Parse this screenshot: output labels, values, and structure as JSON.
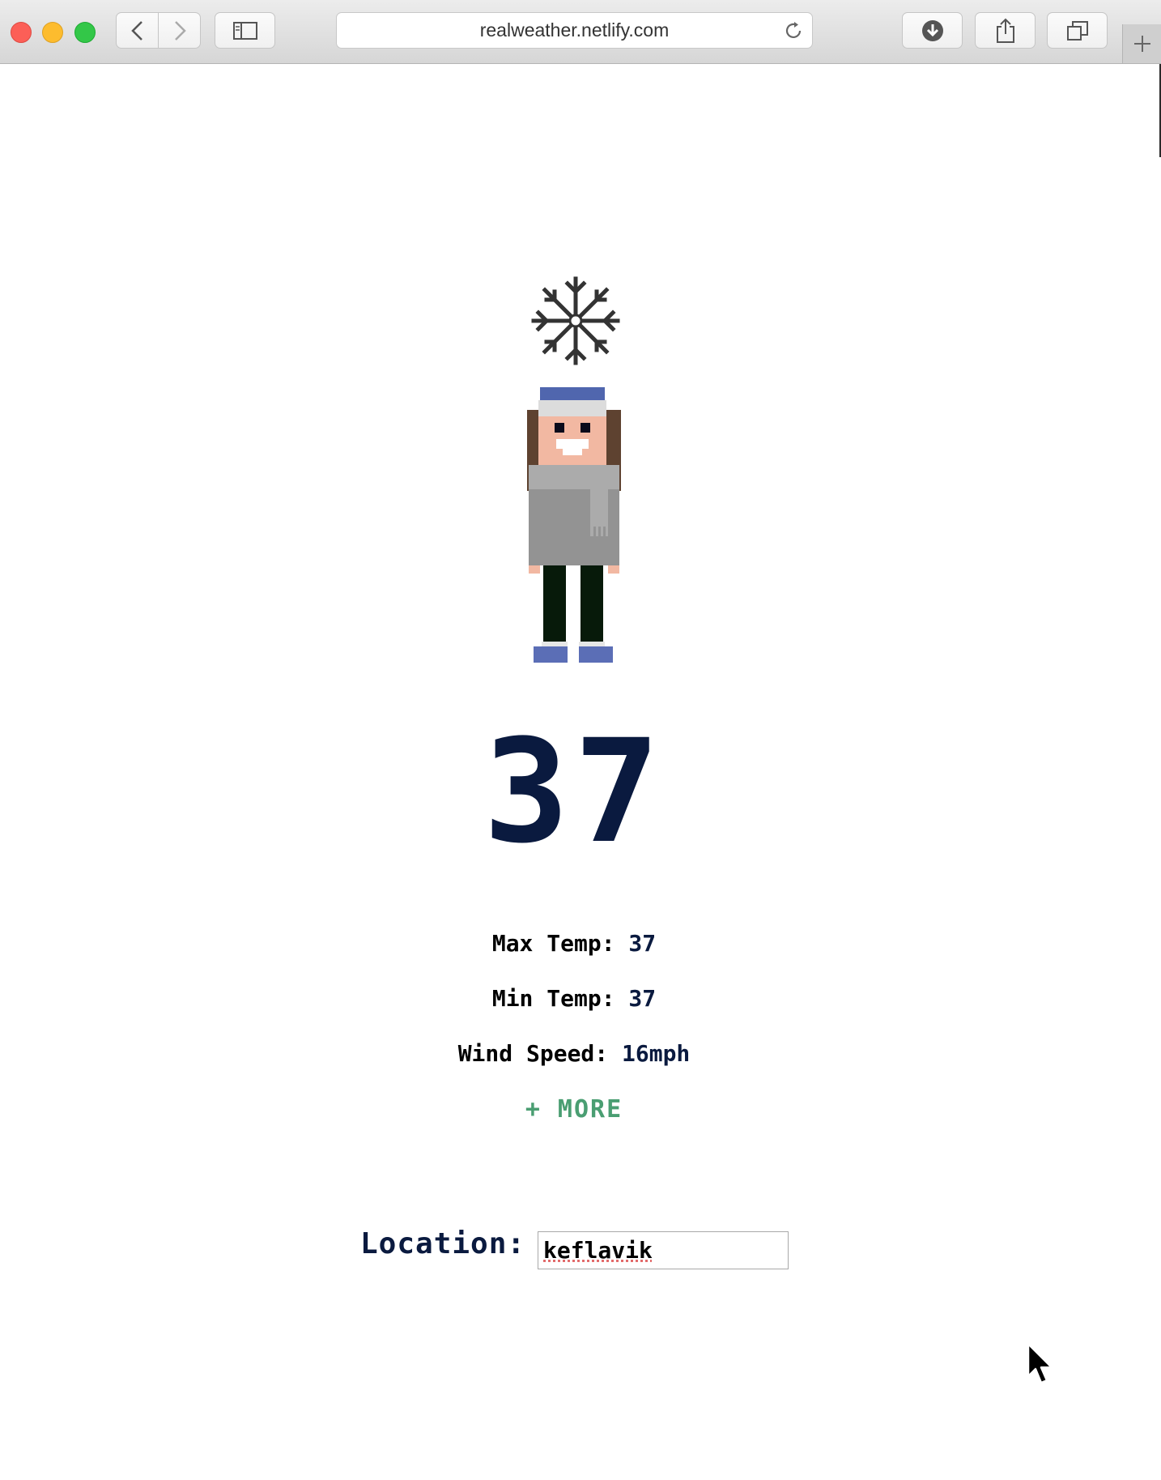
{
  "browser": {
    "url": "realweather.netlify.com",
    "icons": {
      "back": "chevron-left-icon",
      "forward": "chevron-right-icon",
      "sidebar": "sidebar-icon",
      "reload": "reload-icon",
      "download": "download-icon",
      "share": "share-icon",
      "tabs": "tabs-icon",
      "new_tab": "plus-icon"
    }
  },
  "weather": {
    "condition_icon": "snowflake-icon",
    "temperature": "37",
    "stats": {
      "max_label": "Max Temp:",
      "max_value": "37",
      "min_label": "Min Temp:",
      "min_value": "37",
      "wind_label": "Wind Speed:",
      "wind_value": "16mph"
    },
    "more_label": "+ MORE"
  },
  "location": {
    "label": "Location:",
    "value": "keflavik"
  },
  "colors": {
    "navy": "#0a1a3f",
    "green": "#4a9e72"
  }
}
